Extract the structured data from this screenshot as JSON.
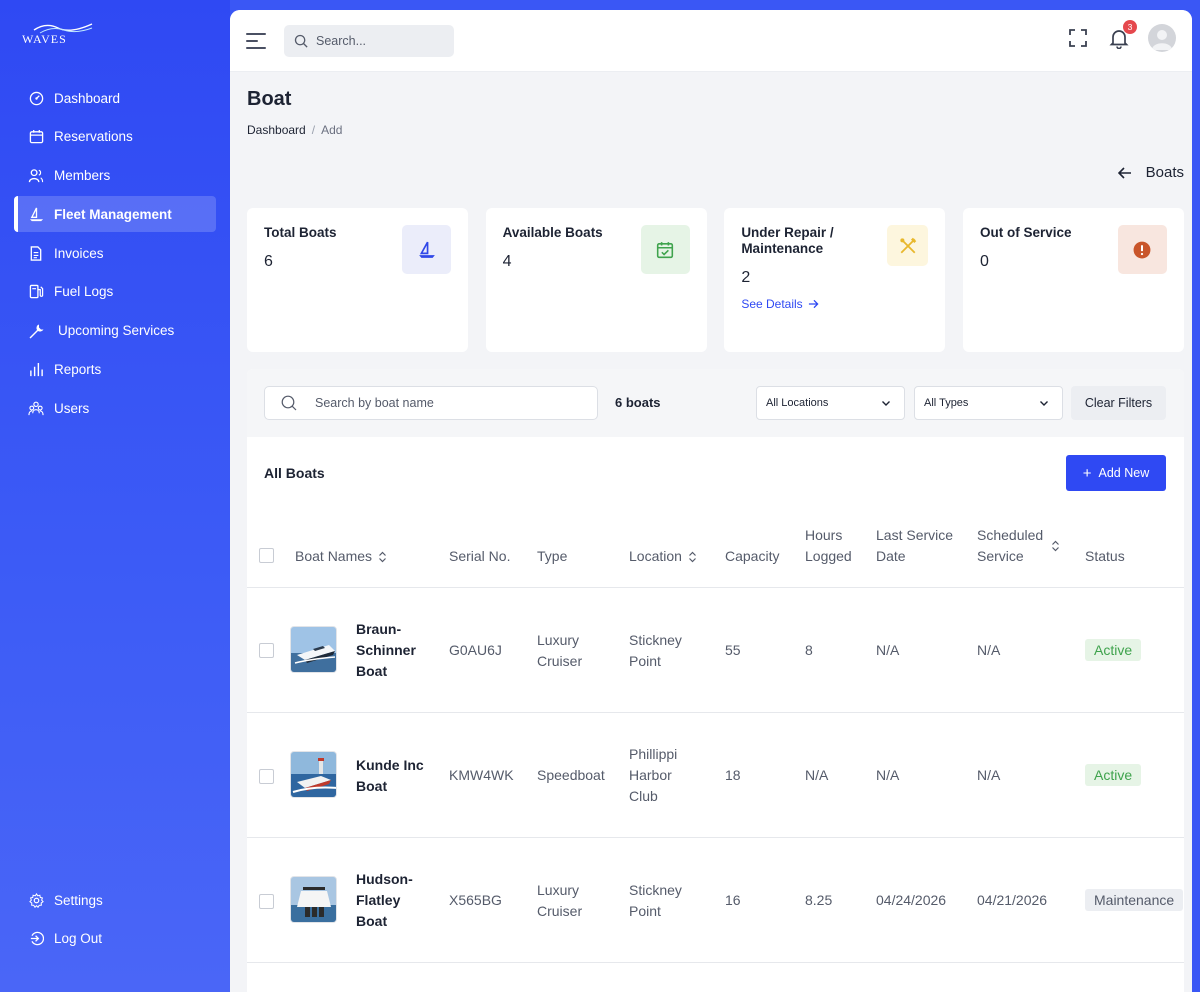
{
  "brand": {
    "logo_text": "WAVES"
  },
  "sidebar": {
    "items": [
      {
        "label": "Dashboard",
        "icon": "dashboard-icon"
      },
      {
        "label": "Reservations",
        "icon": "calendar-icon"
      },
      {
        "label": "Members",
        "icon": "members-icon"
      },
      {
        "label": "Fleet Management",
        "icon": "sailboat-icon",
        "active": true
      },
      {
        "label": "Invoices",
        "icon": "invoice-icon"
      },
      {
        "label": "Fuel Logs",
        "icon": "fuel-icon"
      },
      {
        "label": "Upcoming Services",
        "icon": "wrench-icon"
      },
      {
        "label": "Reports",
        "icon": "bar-chart-icon"
      },
      {
        "label": "Users",
        "icon": "users-icon"
      }
    ],
    "bottom": [
      {
        "label": "Settings",
        "icon": "gear-icon"
      },
      {
        "label": "Log Out",
        "icon": "logout-icon"
      }
    ]
  },
  "topbar": {
    "search_placeholder": "Search...",
    "notification_count": "3"
  },
  "page": {
    "title": "Boat",
    "breadcrumb": {
      "root": "Dashboard",
      "sep": "/",
      "current": "Add"
    },
    "back_label": "Boats"
  },
  "stats": [
    {
      "label": "Total Boats",
      "value": "6",
      "icon": "sailboat-icon",
      "color": "#3048e8",
      "bg": "#ebedfa"
    },
    {
      "label": "Available Boats",
      "value": "4",
      "icon": "calendar-check-icon",
      "color": "#3fa34d",
      "bg": "#e6f4e6"
    },
    {
      "label": "Under Repair / Maintenance",
      "value": "2",
      "link": "See Details",
      "icon": "tools-icon",
      "color": "#e8b82c",
      "bg": "#fdf6de"
    },
    {
      "label": "Out of Service",
      "value": "0",
      "icon": "alert-icon",
      "color": "#c9552a",
      "bg": "#f8e6df"
    }
  ],
  "filters": {
    "search_placeholder": "Search by boat name",
    "count": "6 boats",
    "location": "All Locations",
    "type": "All Types",
    "clear": "Clear Filters"
  },
  "list": {
    "title": "All Boats",
    "add_label": "Add New"
  },
  "table": {
    "headers": {
      "name": "Boat Names",
      "serial": "Serial No.",
      "type": "Type",
      "location": "Location",
      "capacity": "Capacity",
      "hours_1": "Hours",
      "hours_2": "Logged",
      "last_1": "Last Service",
      "last_2": "Date",
      "sched_1": "Scheduled",
      "sched_2": "Service",
      "status": "Status"
    },
    "rows": [
      {
        "name_1": "Braun-",
        "name_2": "Schinner",
        "name_3": "Boat",
        "serial": "G0AU6J",
        "type_1": "Luxury",
        "type_2": "Cruiser",
        "loc_1": "Stickney",
        "loc_2": "Point",
        "loc_3": "",
        "capacity": "55",
        "hours": "8",
        "last": "N/A",
        "sched": "N/A",
        "status": "Active"
      },
      {
        "name_1": "Kunde Inc",
        "name_2": "Boat",
        "name_3": "",
        "serial": "KMW4WK",
        "type_1": "Speedboat",
        "type_2": "",
        "loc_1": "Phillippi",
        "loc_2": "Harbor",
        "loc_3": "Club",
        "capacity": "18",
        "hours": "N/A",
        "last": "N/A",
        "sched": "N/A",
        "status": "Active"
      },
      {
        "name_1": "Hudson-",
        "name_2": "Flatley",
        "name_3": "Boat",
        "serial": "X565BG",
        "type_1": "Luxury",
        "type_2": "Cruiser",
        "loc_1": "Stickney",
        "loc_2": "Point",
        "loc_3": "",
        "capacity": "16",
        "hours": "8.25",
        "last": "04/24/2026",
        "sched": "04/21/2026",
        "status": "Maintenance"
      }
    ]
  }
}
